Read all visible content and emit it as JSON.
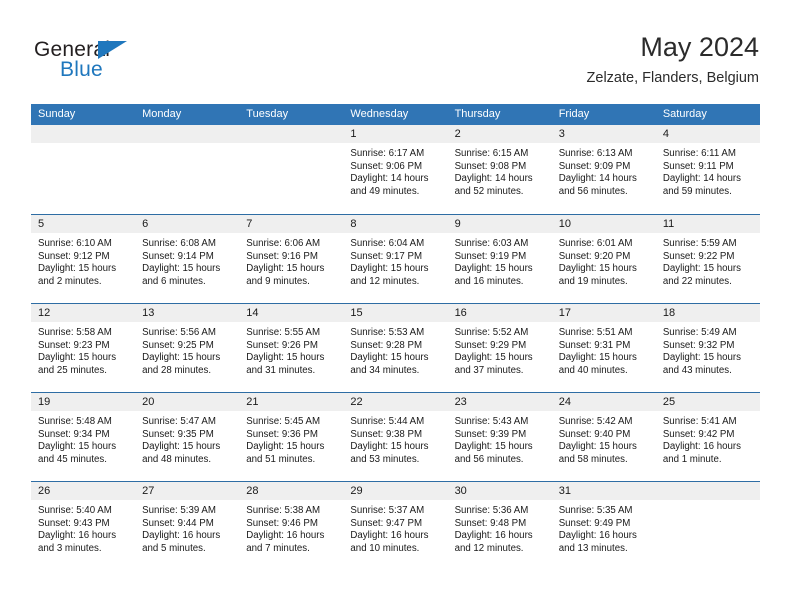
{
  "brand": {
    "name_top": "General",
    "name_bottom": "Blue",
    "triangle_icon": "triangle-icon",
    "color_dark": "#231f20",
    "color_blue": "#1f77bd"
  },
  "header": {
    "title": "May 2024",
    "subtitle": "Zelzate, Flanders, Belgium"
  },
  "theme": {
    "header_blue": "#3075b5",
    "separator_blue": "#2e6da4",
    "day_strip_gray": "#efefef"
  },
  "weekdays": [
    "Sunday",
    "Monday",
    "Tuesday",
    "Wednesday",
    "Thursday",
    "Friday",
    "Saturday"
  ],
  "weeks": [
    [
      {
        "day": "",
        "lines": []
      },
      {
        "day": "",
        "lines": []
      },
      {
        "day": "",
        "lines": []
      },
      {
        "day": "1",
        "lines": [
          "Sunrise: 6:17 AM",
          "Sunset: 9:06 PM",
          "Daylight: 14 hours",
          "and 49 minutes."
        ]
      },
      {
        "day": "2",
        "lines": [
          "Sunrise: 6:15 AM",
          "Sunset: 9:08 PM",
          "Daylight: 14 hours",
          "and 52 minutes."
        ]
      },
      {
        "day": "3",
        "lines": [
          "Sunrise: 6:13 AM",
          "Sunset: 9:09 PM",
          "Daylight: 14 hours",
          "and 56 minutes."
        ]
      },
      {
        "day": "4",
        "lines": [
          "Sunrise: 6:11 AM",
          "Sunset: 9:11 PM",
          "Daylight: 14 hours",
          "and 59 minutes."
        ]
      }
    ],
    [
      {
        "day": "5",
        "lines": [
          "Sunrise: 6:10 AM",
          "Sunset: 9:12 PM",
          "Daylight: 15 hours",
          "and 2 minutes."
        ]
      },
      {
        "day": "6",
        "lines": [
          "Sunrise: 6:08 AM",
          "Sunset: 9:14 PM",
          "Daylight: 15 hours",
          "and 6 minutes."
        ]
      },
      {
        "day": "7",
        "lines": [
          "Sunrise: 6:06 AM",
          "Sunset: 9:16 PM",
          "Daylight: 15 hours",
          "and 9 minutes."
        ]
      },
      {
        "day": "8",
        "lines": [
          "Sunrise: 6:04 AM",
          "Sunset: 9:17 PM",
          "Daylight: 15 hours",
          "and 12 minutes."
        ]
      },
      {
        "day": "9",
        "lines": [
          "Sunrise: 6:03 AM",
          "Sunset: 9:19 PM",
          "Daylight: 15 hours",
          "and 16 minutes."
        ]
      },
      {
        "day": "10",
        "lines": [
          "Sunrise: 6:01 AM",
          "Sunset: 9:20 PM",
          "Daylight: 15 hours",
          "and 19 minutes."
        ]
      },
      {
        "day": "11",
        "lines": [
          "Sunrise: 5:59 AM",
          "Sunset: 9:22 PM",
          "Daylight: 15 hours",
          "and 22 minutes."
        ]
      }
    ],
    [
      {
        "day": "12",
        "lines": [
          "Sunrise: 5:58 AM",
          "Sunset: 9:23 PM",
          "Daylight: 15 hours",
          "and 25 minutes."
        ]
      },
      {
        "day": "13",
        "lines": [
          "Sunrise: 5:56 AM",
          "Sunset: 9:25 PM",
          "Daylight: 15 hours",
          "and 28 minutes."
        ]
      },
      {
        "day": "14",
        "lines": [
          "Sunrise: 5:55 AM",
          "Sunset: 9:26 PM",
          "Daylight: 15 hours",
          "and 31 minutes."
        ]
      },
      {
        "day": "15",
        "lines": [
          "Sunrise: 5:53 AM",
          "Sunset: 9:28 PM",
          "Daylight: 15 hours",
          "and 34 minutes."
        ]
      },
      {
        "day": "16",
        "lines": [
          "Sunrise: 5:52 AM",
          "Sunset: 9:29 PM",
          "Daylight: 15 hours",
          "and 37 minutes."
        ]
      },
      {
        "day": "17",
        "lines": [
          "Sunrise: 5:51 AM",
          "Sunset: 9:31 PM",
          "Daylight: 15 hours",
          "and 40 minutes."
        ]
      },
      {
        "day": "18",
        "lines": [
          "Sunrise: 5:49 AM",
          "Sunset: 9:32 PM",
          "Daylight: 15 hours",
          "and 43 minutes."
        ]
      }
    ],
    [
      {
        "day": "19",
        "lines": [
          "Sunrise: 5:48 AM",
          "Sunset: 9:34 PM",
          "Daylight: 15 hours",
          "and 45 minutes."
        ]
      },
      {
        "day": "20",
        "lines": [
          "Sunrise: 5:47 AM",
          "Sunset: 9:35 PM",
          "Daylight: 15 hours",
          "and 48 minutes."
        ]
      },
      {
        "day": "21",
        "lines": [
          "Sunrise: 5:45 AM",
          "Sunset: 9:36 PM",
          "Daylight: 15 hours",
          "and 51 minutes."
        ]
      },
      {
        "day": "22",
        "lines": [
          "Sunrise: 5:44 AM",
          "Sunset: 9:38 PM",
          "Daylight: 15 hours",
          "and 53 minutes."
        ]
      },
      {
        "day": "23",
        "lines": [
          "Sunrise: 5:43 AM",
          "Sunset: 9:39 PM",
          "Daylight: 15 hours",
          "and 56 minutes."
        ]
      },
      {
        "day": "24",
        "lines": [
          "Sunrise: 5:42 AM",
          "Sunset: 9:40 PM",
          "Daylight: 15 hours",
          "and 58 minutes."
        ]
      },
      {
        "day": "25",
        "lines": [
          "Sunrise: 5:41 AM",
          "Sunset: 9:42 PM",
          "Daylight: 16 hours",
          "and 1 minute."
        ]
      }
    ],
    [
      {
        "day": "26",
        "lines": [
          "Sunrise: 5:40 AM",
          "Sunset: 9:43 PM",
          "Daylight: 16 hours",
          "and 3 minutes."
        ]
      },
      {
        "day": "27",
        "lines": [
          "Sunrise: 5:39 AM",
          "Sunset: 9:44 PM",
          "Daylight: 16 hours",
          "and 5 minutes."
        ]
      },
      {
        "day": "28",
        "lines": [
          "Sunrise: 5:38 AM",
          "Sunset: 9:46 PM",
          "Daylight: 16 hours",
          "and 7 minutes."
        ]
      },
      {
        "day": "29",
        "lines": [
          "Sunrise: 5:37 AM",
          "Sunset: 9:47 PM",
          "Daylight: 16 hours",
          "and 10 minutes."
        ]
      },
      {
        "day": "30",
        "lines": [
          "Sunrise: 5:36 AM",
          "Sunset: 9:48 PM",
          "Daylight: 16 hours",
          "and 12 minutes."
        ]
      },
      {
        "day": "31",
        "lines": [
          "Sunrise: 5:35 AM",
          "Sunset: 9:49 PM",
          "Daylight: 16 hours",
          "and 13 minutes."
        ]
      },
      {
        "day": "",
        "lines": []
      }
    ]
  ]
}
